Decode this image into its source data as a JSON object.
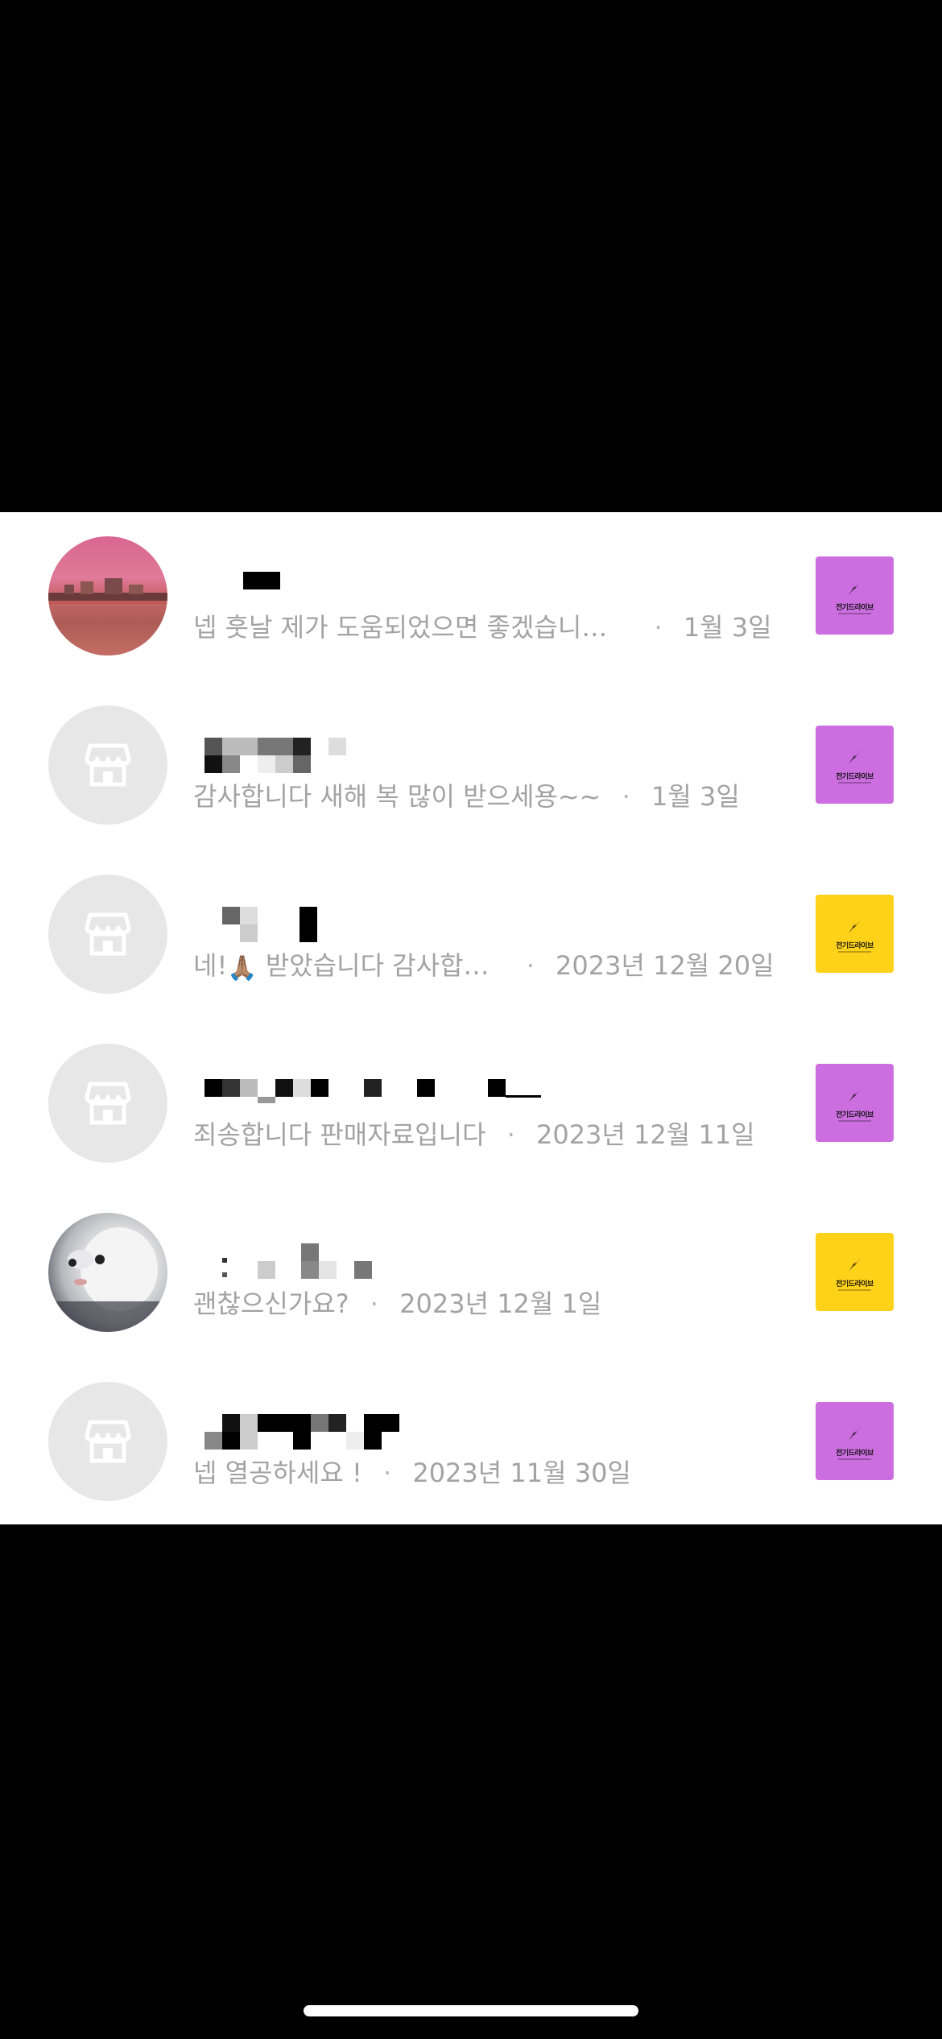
{
  "chats": [
    {
      "avatar": "photo",
      "avatar_icon": "sunset-harbor-photo",
      "message": "넵 훗날 제가 도움되었으면 좋겠습니…",
      "separator": "·",
      "date": "1월 3일",
      "thumb_color": "#cc6ee0",
      "thumb_label": "전기드라이브"
    },
    {
      "avatar": "placeholder",
      "avatar_icon": "store-icon",
      "message": "감사합니다 새해 복 많이 받으세용~~",
      "separator": "·",
      "date": "1월 3일",
      "thumb_color": "#cc6ee0",
      "thumb_label": "전기드라이브"
    },
    {
      "avatar": "placeholder",
      "avatar_icon": "store-icon",
      "message_prefix": "네!",
      "message_emoji": "🙏🏽",
      "message": "받았습니다 감사합…",
      "separator": "·",
      "date": "2023년 12월 20일",
      "thumb_color": "#ffd21a",
      "thumb_label": "전기드라이브"
    },
    {
      "avatar": "placeholder",
      "avatar_icon": "store-icon",
      "message": "죄송합니다 판매자료입니다",
      "separator": "·",
      "date": "2023년 12월 11일",
      "thumb_color": "#cc6ee0",
      "thumb_label": "전기드라이브"
    },
    {
      "avatar": "photo",
      "avatar_icon": "white-dog-photo",
      "message": "괜찮으신가요?",
      "separator": "·",
      "date": "2023년 12월 1일",
      "thumb_color": "#ffd21a",
      "thumb_label": "전기드라이브"
    },
    {
      "avatar": "placeholder",
      "avatar_icon": "store-icon",
      "message": "넵 열공하세요 !",
      "separator": "·",
      "date": "2023년 11월 30일",
      "thumb_color": "#cc6ee0",
      "thumb_label": "전기드라이브"
    }
  ]
}
